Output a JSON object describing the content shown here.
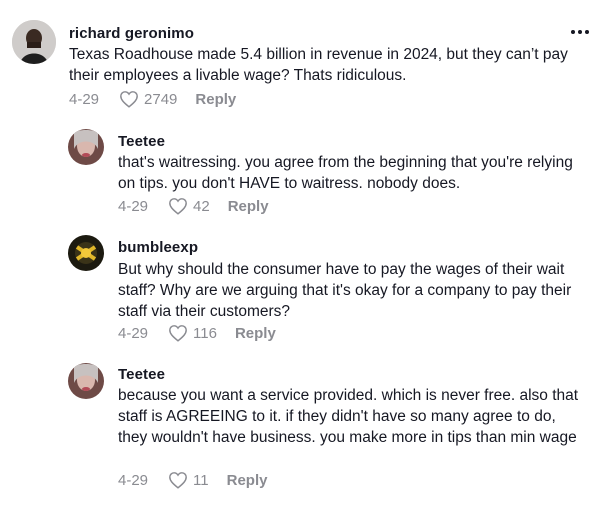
{
  "comments": [
    {
      "username": "richard geronimo",
      "text": "Texas Roadhouse made 5.4 billion in revenue in 2024, but they can’t pay their employees a livable wage? Thats ridiculous.",
      "date": "4-29",
      "likes": "2749",
      "reply_label": "Reply"
    },
    {
      "username": "Teetee",
      "text": "that's waitressing. you agree from the beginning that you're relying on tips. you don't HAVE to waitress. nobody does.",
      "date": "4-29",
      "likes": "42",
      "reply_label": "Reply"
    },
    {
      "username": "bumbleexp",
      "text": "But why should the consumer have to pay the wages of their wait staff? Why are we arguing that it's okay for a company to pay their staff via their customers?",
      "date": "4-29",
      "likes": "116",
      "reply_label": "Reply"
    },
    {
      "username": "Teetee",
      "text": "because you want a service provided. which is never free. also that staff is AGREEING to it. if they didn't have so many agree to do, they wouldn't have business. you make more in tips than min wage",
      "date": "4-29",
      "likes": "11",
      "reply_label": "Reply"
    }
  ],
  "icons": {
    "more": "more-options-icon",
    "like": "heart-outline-icon"
  },
  "colors": {
    "text_primary": "#161823",
    "text_secondary": "#8a8b91"
  }
}
